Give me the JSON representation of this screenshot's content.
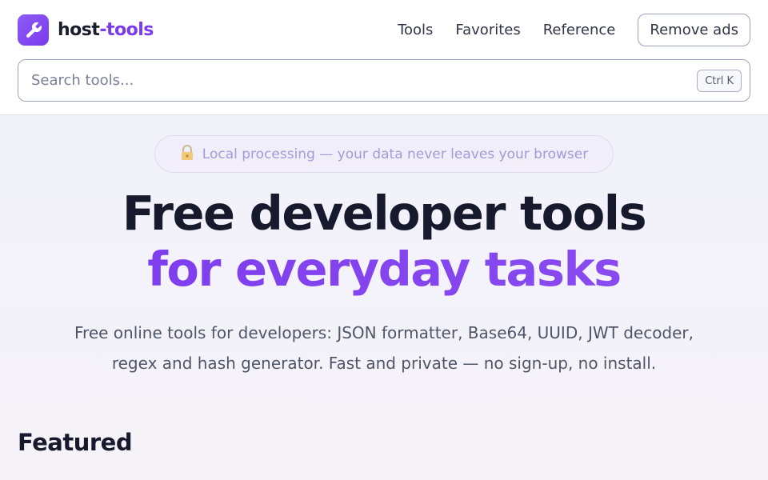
{
  "header": {
    "logo": {
      "icon": "wrench-icon",
      "name_part1": "host",
      "name_part2": "-tools"
    },
    "nav": [
      {
        "label": "Tools"
      },
      {
        "label": "Favorites"
      },
      {
        "label": "Reference"
      }
    ],
    "remove_ads_label": "Remove ads",
    "search": {
      "placeholder": "Search tools...",
      "shortcut": "Ctrl K"
    }
  },
  "hero": {
    "badge": {
      "icon": "lock-icon",
      "text": "Local processing — your data never leaves your browser"
    },
    "title_line1": "Free developer tools",
    "title_line2": "for everyday tasks",
    "subtitle_line1": "Free online tools for developers: JSON formatter, Base64, UUID, JWT decoder,",
    "subtitle_line2": "regex and hash generator. Fast and private — no sign-up, no install."
  },
  "featured": {
    "title": "Featured"
  },
  "colors": {
    "accent": "#7c3aed",
    "text": "#161a2c"
  }
}
